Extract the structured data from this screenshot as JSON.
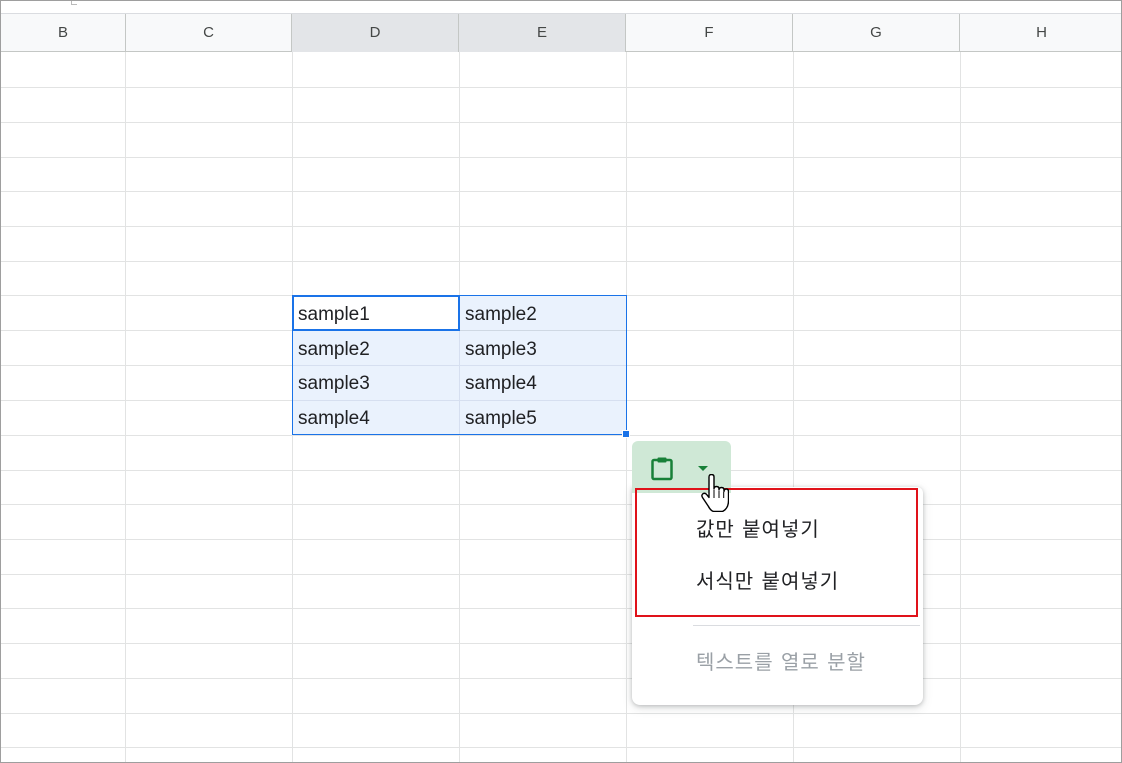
{
  "columns": [
    "B",
    "C",
    "D",
    "E",
    "F",
    "G",
    "H"
  ],
  "cells": {
    "d1": "sample1",
    "e1": "sample2",
    "d2": "sample2",
    "e2": "sample3",
    "d3": "sample3",
    "e3": "sample4",
    "d4": "sample4",
    "e4": "sample5"
  },
  "paste_menu": {
    "items": [
      "값만 붙여넣기",
      "서식만 붙여넣기"
    ],
    "disabled_item": "텍스트를 열로 분할"
  },
  "colors": {
    "selection": "#1a73e8",
    "paste_chip": "#cfe8d6",
    "paste_icon": "#188038",
    "highlight_box": "#e0121a"
  },
  "icons": {
    "paste": "clipboard-icon",
    "dropdown": "caret-down-icon",
    "pointer": "hand-cursor-icon"
  }
}
